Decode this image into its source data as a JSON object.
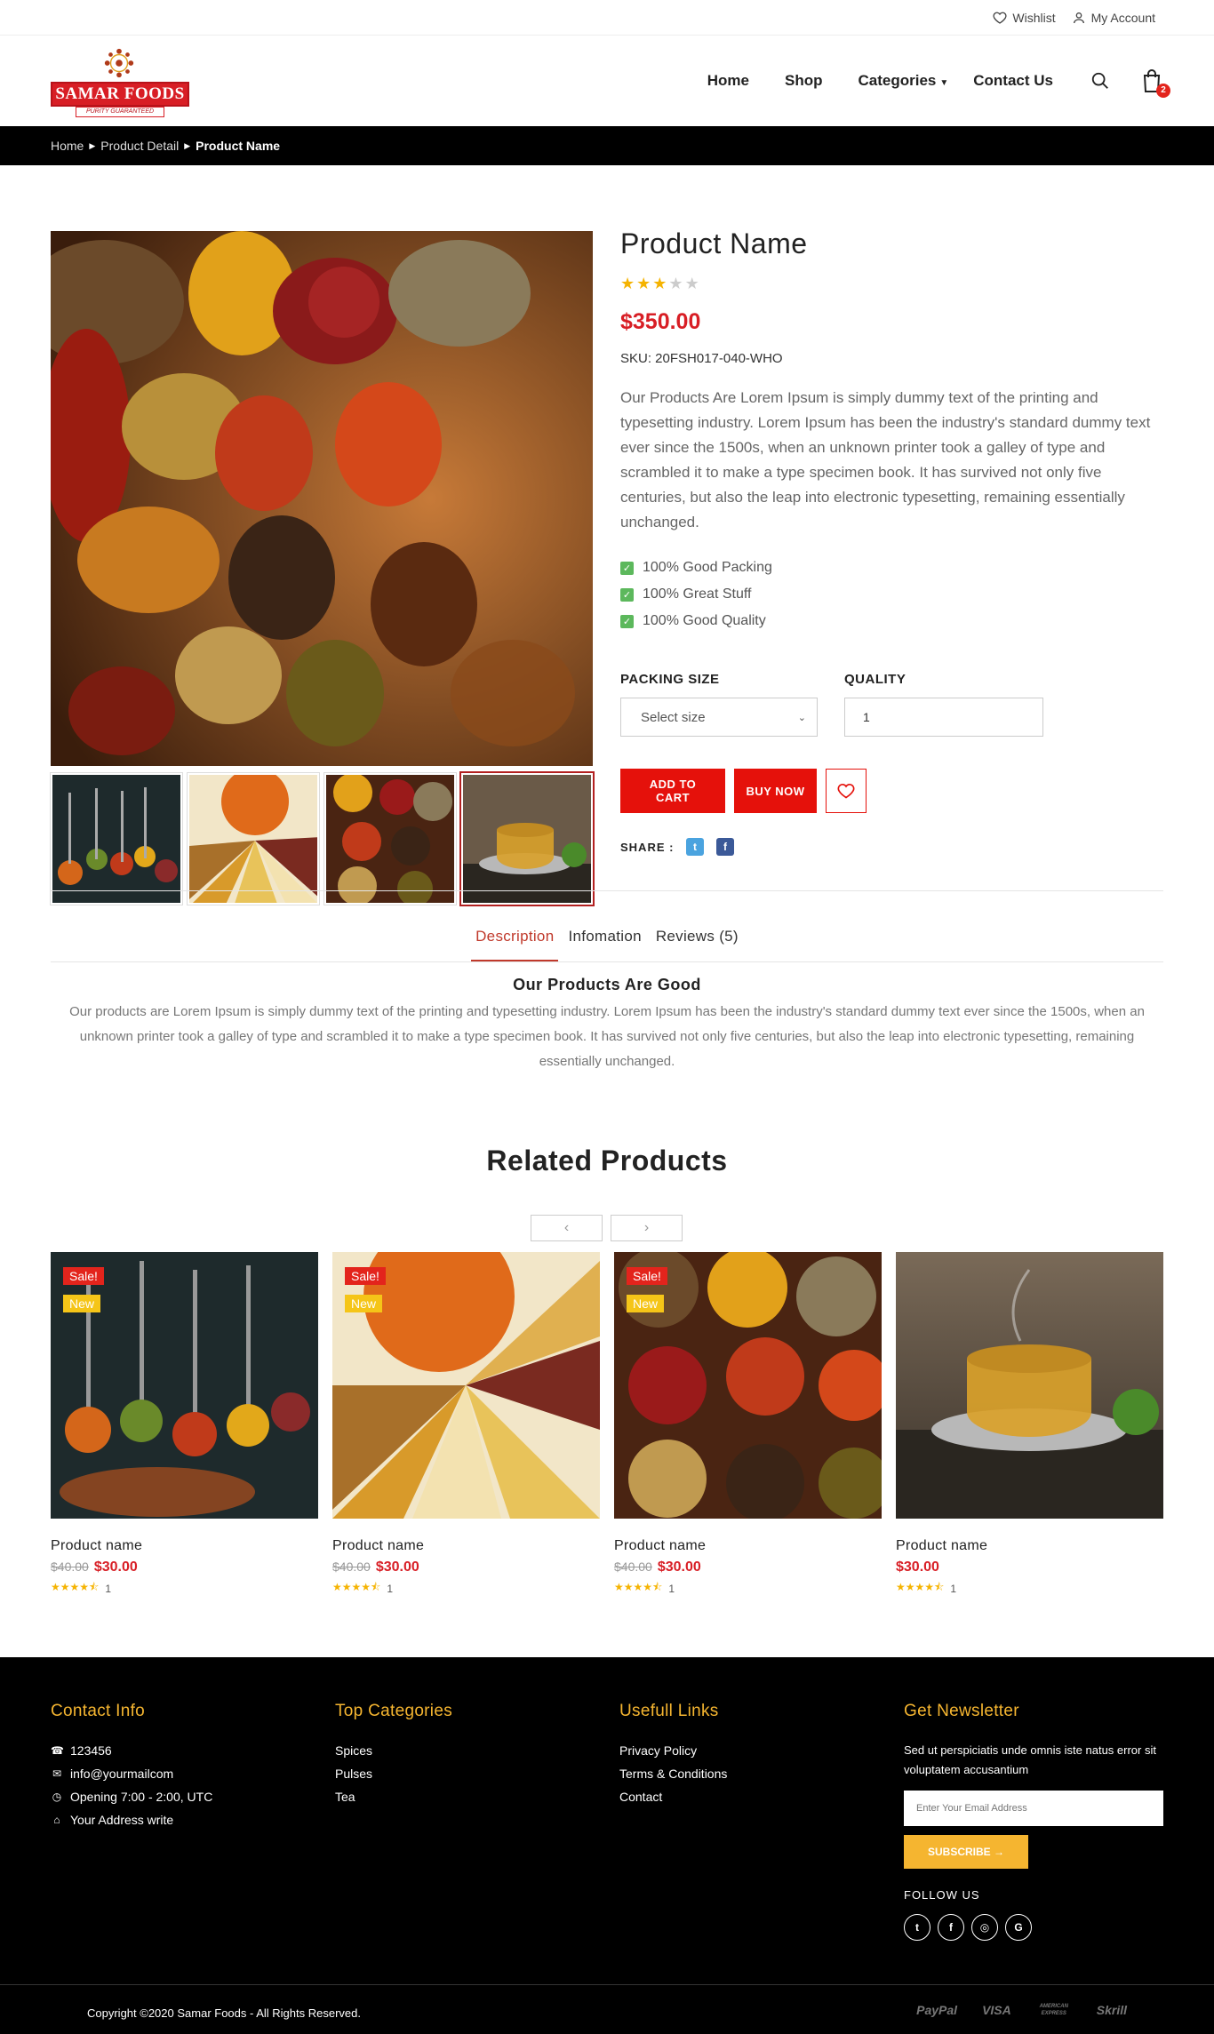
{
  "topbar": {
    "wishlist": "Wishlist",
    "account": "My Account"
  },
  "logo": {
    "brand": "SAMAR FOODS",
    "tagline": "PURITY GUARANTEED"
  },
  "nav": {
    "home": "Home",
    "shop": "Shop",
    "categories": "Categories",
    "contact": "Contact Us",
    "cart_count": "2"
  },
  "breadcrumb": {
    "home": "Home",
    "detail": "Product Detail",
    "current": "Product Name"
  },
  "product": {
    "title": "Product Name",
    "rating": 3,
    "rating_max": 5,
    "price": "$350.00",
    "sku": "SKU: 20FSH017-040-WHO",
    "description": "Our Products Are Lorem Ipsum is simply dummy text of the printing and typesetting industry. Lorem Ipsum has been the industry's standard dummy text ever since the 1500s, when an unknown printer took a galley of type and scrambled it to make a type specimen book. It has survived not only five centuries, but also the leap into electronic typesetting, remaining essentially unchanged.",
    "features": [
      "100% Good Packing",
      "100% Great Stuff",
      "100% Good Quality"
    ],
    "packing_label": "PACKING SIZE",
    "packing_value": "Select size",
    "quality_label": "QUALITY",
    "quality_value": "1",
    "add_to_cart": "ADD TO CART",
    "buy_now": "BUY NOW",
    "share_label": "SHARE :"
  },
  "tabs": {
    "items": [
      "Description",
      "Infomation",
      "Reviews (5)"
    ],
    "active": 0
  },
  "description": {
    "heading": "Our Products Are Good",
    "text": "Our products are Lorem Ipsum is simply dummy text of the printing and typesetting industry. Lorem Ipsum has been the industry's standard dummy text ever since the 1500s, when an unknown printer took a galley of type and scrambled it to make a type specimen book. It has survived not only five centuries, but also the leap into electronic typesetting, remaining essentially unchanged."
  },
  "related": {
    "title": "Related Products",
    "items": [
      {
        "name": "Product name",
        "old_price": "$40.00",
        "price": "$30.00",
        "rating_count": "1",
        "sale": "Sale!",
        "new": "New"
      },
      {
        "name": "Product name",
        "old_price": "$40.00",
        "price": "$30.00",
        "rating_count": "1",
        "sale": "Sale!",
        "new": "New"
      },
      {
        "name": "Product name",
        "old_price": "$40.00",
        "price": "$30.00",
        "rating_count": "1",
        "sale": "Sale!",
        "new": "New"
      },
      {
        "name": "Product name",
        "old_price": "",
        "price": "$30.00",
        "rating_count": "1",
        "sale": "",
        "new": ""
      }
    ]
  },
  "footer": {
    "contact_title": "Contact Info",
    "contact": {
      "phone": "123456",
      "email": "info@yourmailcom",
      "hours": "Opening 7:00 - 2:00, UTC",
      "address": "Your Address write"
    },
    "categories_title": "Top Categories",
    "categories": [
      "Spices",
      "Pulses",
      "Tea"
    ],
    "links_title": "Usefull Links",
    "links": [
      "Privacy Policy",
      "Terms & Conditions",
      "Contact"
    ],
    "newsletter_title": "Get Newsletter",
    "newsletter_text": "Sed ut perspiciatis unde omnis iste natus error sit voluptatem accusantium",
    "email_placeholder": "Enter Your Email Address",
    "subscribe": "SUBSCRIBE →",
    "follow": "FOLLOW US",
    "copyright": "Copyright ©2020 Samar Foods - All Rights Reserved.",
    "payments": [
      "PayPal",
      "VISA",
      "AMERICAN EXPRESS",
      "Skrill"
    ]
  },
  "colors": {
    "accent": "#d81e25",
    "gold": "#f5b530",
    "star": "#f5b301"
  }
}
